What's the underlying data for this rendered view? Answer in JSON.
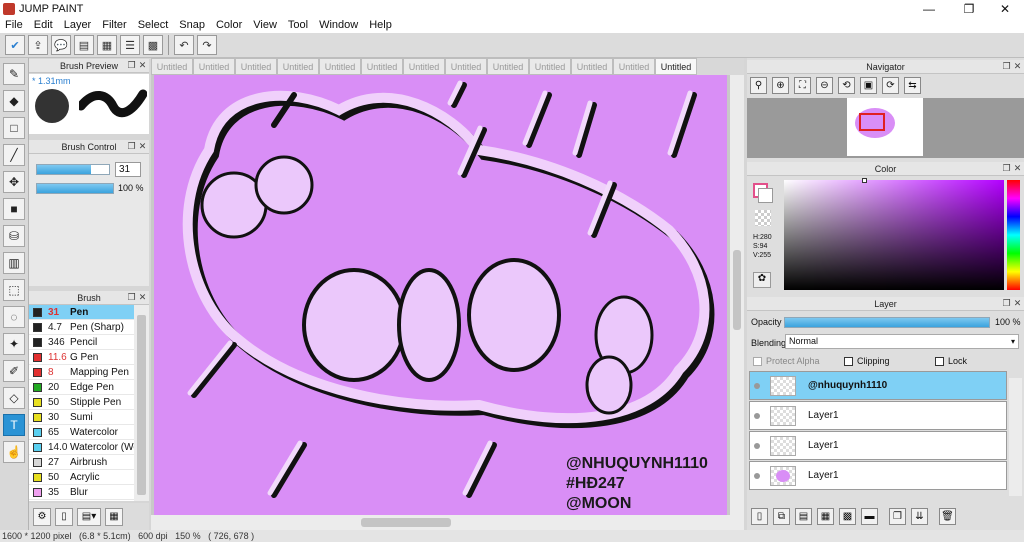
{
  "app": {
    "title": "JUMP PAINT"
  },
  "window_controls": {
    "minimize": "—",
    "maximize": "❐",
    "close": "✕"
  },
  "menu": [
    "File",
    "Edit",
    "Layer",
    "Filter",
    "Select",
    "Snap",
    "Color",
    "View",
    "Tool",
    "Window",
    "Help"
  ],
  "brush_preview": {
    "title": "Brush Preview",
    "size": "* 1.31mm"
  },
  "brush_control": {
    "title": "Brush Control",
    "size_value": "31",
    "opacity_value": "100 %",
    "size_level": 0.75,
    "opacity_level": 1.0
  },
  "brush": {
    "title": "Brush",
    "items": [
      {
        "size": "31",
        "name": "Pen",
        "color": "#222222",
        "selected": true
      },
      {
        "size": "4.7",
        "name": "Pen (Sharp)",
        "color": "#222222"
      },
      {
        "size": "346",
        "name": "Pencil",
        "color": "#222222"
      },
      {
        "size": "11.6",
        "name": "G Pen",
        "color": "#e23030"
      },
      {
        "size": "8",
        "name": "Mapping Pen",
        "color": "#e23030"
      },
      {
        "size": "20",
        "name": "Edge Pen",
        "color": "#22aa22"
      },
      {
        "size": "50",
        "name": "Stipple Pen",
        "color": "#e8e020"
      },
      {
        "size": "30",
        "name": "Sumi",
        "color": "#e8e020"
      },
      {
        "size": "65",
        "name": "Watercolor",
        "color": "#5ad0f0"
      },
      {
        "size": "14.0",
        "name": "Watercolor (We",
        "color": "#5ad0f0"
      },
      {
        "size": "27",
        "name": "Airbrush",
        "color": "#d8d8d8"
      },
      {
        "size": "50",
        "name": "Acrylic",
        "color": "#e8e020"
      },
      {
        "size": "35",
        "name": "Blur",
        "color": "#f0a0f0"
      }
    ]
  },
  "tabs": [
    "Untitled",
    "Untitled",
    "Untitled",
    "Untitled",
    "Untitled",
    "Untitled",
    "Untitled",
    "Untitled",
    "Untitled",
    "Untitled",
    "Untitled",
    "Untitled",
    "Untitled"
  ],
  "canvas": {
    "signature": [
      "@NHUQUYNH1110",
      "#HĐ247",
      "@MOON"
    ],
    "background": "#d98ef6"
  },
  "navigator": {
    "title": "Navigator"
  },
  "color": {
    "title": "Color",
    "h": "H:280",
    "s": "S:94",
    "v": "V:255",
    "primary": "#e2508a",
    "hue": "#b300ff"
  },
  "layer": {
    "title": "Layer",
    "opacity_label": "Opacity",
    "opacity_value": "100 %",
    "opacity_level": 1.0,
    "blending_label": "Blending",
    "blending_value": "Normal",
    "protect_alpha": "Protect Alpha",
    "clipping": "Clipping",
    "lock": "Lock",
    "layers": [
      {
        "name": "@nhuquynh1110",
        "selected": true
      },
      {
        "name": "Layer1"
      },
      {
        "name": "Layer1"
      },
      {
        "name": "Layer1"
      }
    ]
  },
  "status": {
    "text": "1600 * 1200 pixel   (6.8 * 5.1cm)   600 dpi   150 %   ( 726, 678 )"
  }
}
